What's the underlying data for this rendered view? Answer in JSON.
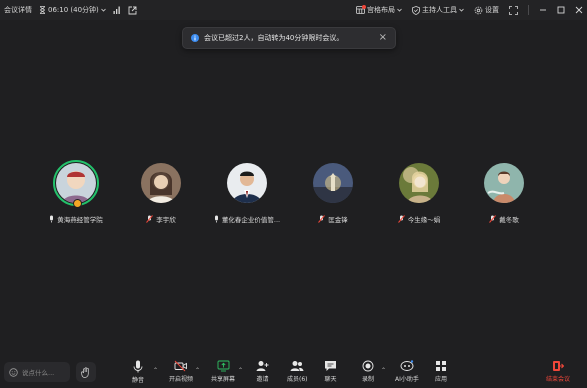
{
  "topbar": {
    "meeting_info": "会议详情",
    "timer": "06:10 (40分钟)",
    "layout": "宫格布局",
    "host_tools": "主持人工具",
    "settings": "设置"
  },
  "toast": {
    "message": "会议已超过2人，自动转为40分钟限时会议。"
  },
  "participants": [
    {
      "name": "黄海燕经管学院",
      "mic": "on",
      "avatar_colors": [
        "#d9c4a7",
        "#b33b3b"
      ]
    },
    {
      "name": "李宇欣",
      "mic": "muted",
      "avatar_colors": [
        "#c7a88a",
        "#3d2a22"
      ]
    },
    {
      "name": "董化春企业价值管...",
      "mic": "on",
      "avatar_colors": [
        "#2a3d5e",
        "#f2f2f2"
      ]
    },
    {
      "name": "匡金锋",
      "mic": "muted",
      "avatar_colors": [
        "#5b6c8f",
        "#c9b07a"
      ]
    },
    {
      "name": "今生缘～娟",
      "mic": "muted",
      "avatar_colors": [
        "#d7c79a",
        "#6b7a3a"
      ]
    },
    {
      "name": "戴冬歌",
      "mic": "muted",
      "avatar_colors": [
        "#8fb5ac",
        "#c98a6a"
      ]
    }
  ],
  "bottombar": {
    "chat_placeholder": "说点什么...",
    "tools": [
      {
        "label": "静音",
        "icon": "microphone-icon"
      },
      {
        "label": "开启视频",
        "icon": "video-off-icon"
      },
      {
        "label": "共享屏幕",
        "icon": "share-screen-icon"
      },
      {
        "label": "邀请",
        "icon": "invite-icon"
      },
      {
        "label": "成员(6)",
        "icon": "members-icon"
      },
      {
        "label": "聊天",
        "icon": "chat-icon"
      },
      {
        "label": "录制",
        "icon": "record-icon"
      },
      {
        "label": "AI小助手",
        "icon": "ai-assistant-icon"
      },
      {
        "label": "应用",
        "icon": "apps-icon"
      }
    ],
    "end_label": "结束会议"
  },
  "colors": {
    "background": "#1f1f21",
    "active_speaker": "#23c16b",
    "danger": "#f0473a",
    "info": "#3c8cf0"
  }
}
